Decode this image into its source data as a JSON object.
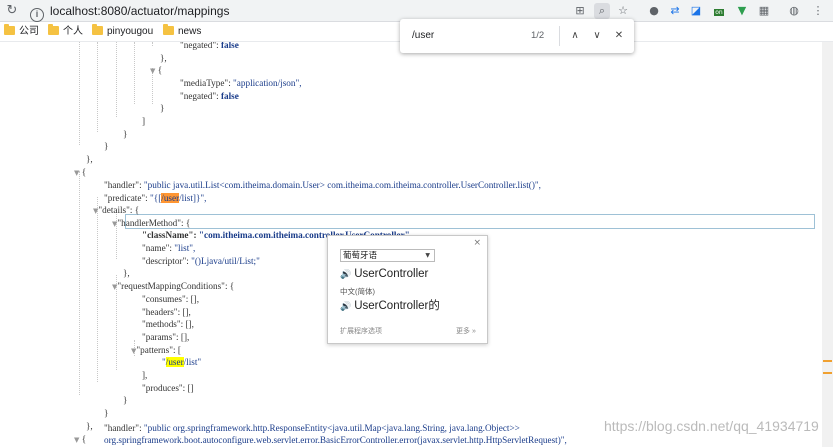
{
  "browser": {
    "url": "localhost:8080/actuator/mappings",
    "bookmarks": [
      {
        "label": "公司"
      },
      {
        "label": "个人"
      },
      {
        "label": "pinyougou"
      },
      {
        "label": "news"
      }
    ],
    "ext_badge": "on"
  },
  "find": {
    "query": "/user",
    "count": "1/2"
  },
  "json": {
    "l01": {
      "key": "\"negated\"",
      "val": "false"
    },
    "l02": "},",
    "l03": "{",
    "l04": {
      "key": "\"mediaType\"",
      "val": "\"application/json\","
    },
    "l05": {
      "key": "\"negated\"",
      "val": "false"
    },
    "l06": "}",
    "l07": "]",
    "l08": "}",
    "l09": "}",
    "l10": "},",
    "l11": "{",
    "handler_key": "\"handler\"",
    "handler_val": "\"public java.util.List<com.itheima.domain.User> com.itheima.com.itheima.controller.UserController.list()\",",
    "predicate_key": "\"predicate\"",
    "predicate_pre": "\"{[",
    "predicate_hit": "/user",
    "predicate_post": "/list]}\",",
    "details_key": "\"details\"",
    "details_open": "{",
    "handlerMethod_key": "\"handlerMethod\"",
    "handlerMethod_open": "{",
    "className_key": "\"className\"",
    "className_val": "\"com.itheima.com.itheima.controller.UserController\",",
    "name_key": "\"name\"",
    "name_val": "\"list\",",
    "descriptor_key": "\"descriptor\"",
    "descriptor_val": "\"()Ljava/util/List;\"",
    "close_hm": "},",
    "rmc_key": "\"requestMappingConditions\"",
    "rmc_open": "{",
    "consumes_key": "\"consumes\"",
    "consumes_val": "[],",
    "headers_key": "\"headers\"",
    "headers_val": "[],",
    "methods_key": "\"methods\"",
    "methods_val": "[],",
    "params_key": "\"params\"",
    "params_val": "[],",
    "patterns_key": "\"patterns\"",
    "patterns_open": "[",
    "pattern_pre": "\"",
    "pattern_hit": "/user",
    "pattern_post": "/list\"",
    "patterns_close": "],",
    "produces_key": "\"produces\"",
    "produces_val": "[]",
    "close_rmc": "}",
    "close_details": "}",
    "close_entry": "},",
    "open_entry2": "{",
    "handler2_key": "\"handler\"",
    "handler2_val": "\"public org.springframework.http.ResponseEntity<java.util.Map<java.lang.String, java.lang.Object>>",
    "handler2_cont": "org.springframework.boot.autoconfigure.web.servlet.error.BasicErrorController.error(javax.servlet.http.HttpServletRequest)\","
  },
  "translate": {
    "source_lang": "葡萄牙语",
    "word": "UserController",
    "target_lang": "中文(简体)",
    "translation": "UserController的",
    "options_link": "扩展程序选项",
    "more_link": "更多 »",
    "close": "×"
  },
  "watermark": "https://blog.csdn.net/qq_41934719"
}
